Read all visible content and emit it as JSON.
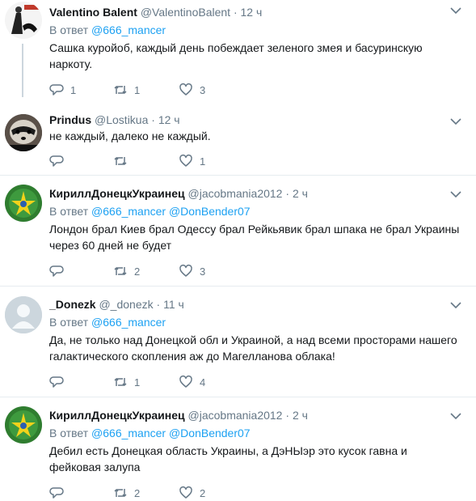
{
  "colors": {
    "text": "#14171a",
    "muted": "#657786",
    "link": "#1da1f2",
    "divider": "#e6ecf0"
  },
  "tweets": [
    {
      "name": "Valentino Balent",
      "handle": "@ValentinoBalent",
      "sep": "·",
      "time": "12 ч",
      "reply_label": "В ответ",
      "reply_to": "@666_mancer",
      "reply_to_2": "",
      "text": "Сашка куройоб, каждый день побеждает зеленого змея и басуринскую наркоту.",
      "replies": "1",
      "retweets": "1",
      "likes": "3"
    },
    {
      "name": "Prindus",
      "handle": "@Lostikua",
      "sep": "·",
      "time": "12 ч",
      "text": "не каждый, далеко не каждый.",
      "replies": "",
      "retweets": "",
      "likes": "1"
    },
    {
      "name": "КириллДонецкУкраинец",
      "handle": "@jacobmania2012",
      "sep": "·",
      "time": "2 ч",
      "reply_label": "В ответ",
      "reply_to": "@666_mancer",
      "reply_to_2": "@DonBender07",
      "text": "Лондон брал Киев брал Одессу брал Рейкьявик брал шпака не брал Украины через 60 дней не будет",
      "replies": "",
      "retweets": "2",
      "likes": "3"
    },
    {
      "name": "_Donezk",
      "handle": "@_donezk",
      "sep": "·",
      "time": "11 ч",
      "reply_label": "В ответ",
      "reply_to": "@666_mancer",
      "reply_to_2": "",
      "text": "Да, не только над Донецкой обл и Украиной, а над всеми просторами нашего галактического скопления аж до Магелланова облака!",
      "replies": "",
      "retweets": "1",
      "likes": "4"
    },
    {
      "name": "КириллДонецкУкраинец",
      "handle": "@jacobmania2012",
      "sep": "·",
      "time": "2 ч",
      "reply_label": "В ответ",
      "reply_to": "@666_mancer",
      "reply_to_2": "@DonBender07",
      "text": "Дебил есть Донецкая область Украины, а ДэНЫэр это кусок гавна и фейковая залупа",
      "replies": "",
      "retweets": "2",
      "likes": "2"
    }
  ]
}
